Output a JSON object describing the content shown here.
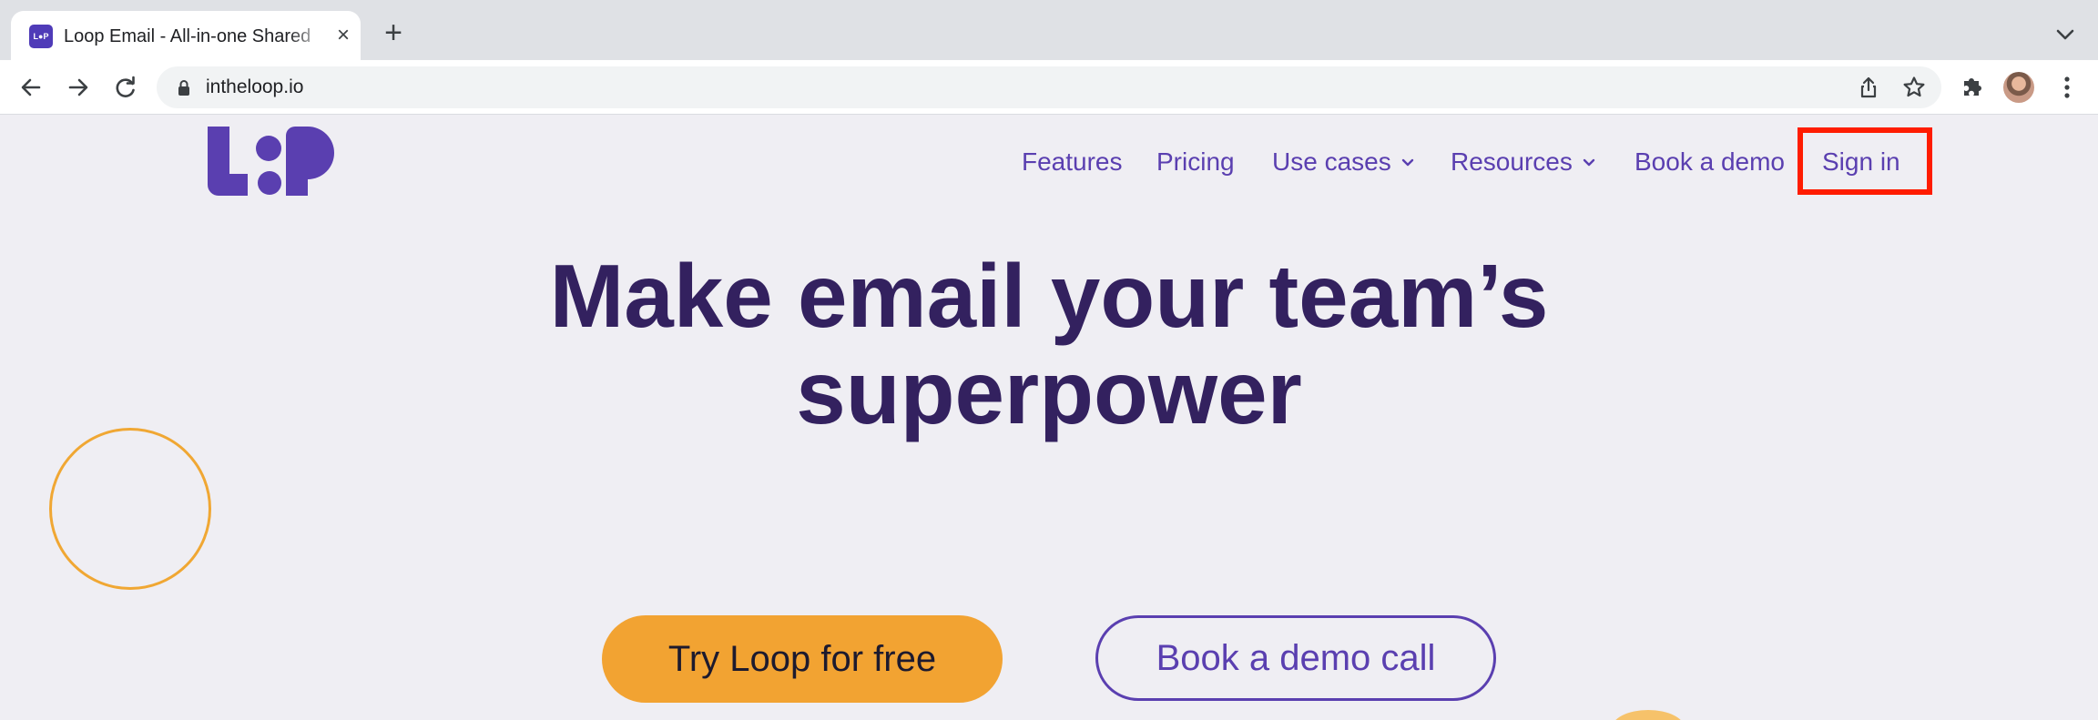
{
  "browser": {
    "tab_title": "Loop Email - All-in-one Shared",
    "tab_close": "×",
    "new_tab": "+",
    "url": "intheloop.io"
  },
  "nav": {
    "items": [
      "Features",
      "Pricing",
      "Use cases",
      "Resources",
      "Book a demo"
    ],
    "sign_in": "Sign in"
  },
  "hero": {
    "title_line1": "Make email your team’s",
    "title_line2": "superpower",
    "cta_primary": "Try Loop for free",
    "cta_secondary": "Book a demo call"
  },
  "colors": {
    "brand_purple": "#5a3fb0",
    "heading": "#33215f",
    "cta_orange": "#f2a332",
    "highlight_red": "#ff1c00",
    "background": "#efeef3"
  },
  "icons": [
    "loop-favicon",
    "close-icon",
    "plus-icon",
    "chevron-down-icon",
    "back-arrow-icon",
    "forward-arrow-icon",
    "reload-icon",
    "lock-icon",
    "share-icon",
    "star-icon",
    "puzzle-icon",
    "avatar",
    "kebab-menu-icon",
    "loop-logo"
  ]
}
